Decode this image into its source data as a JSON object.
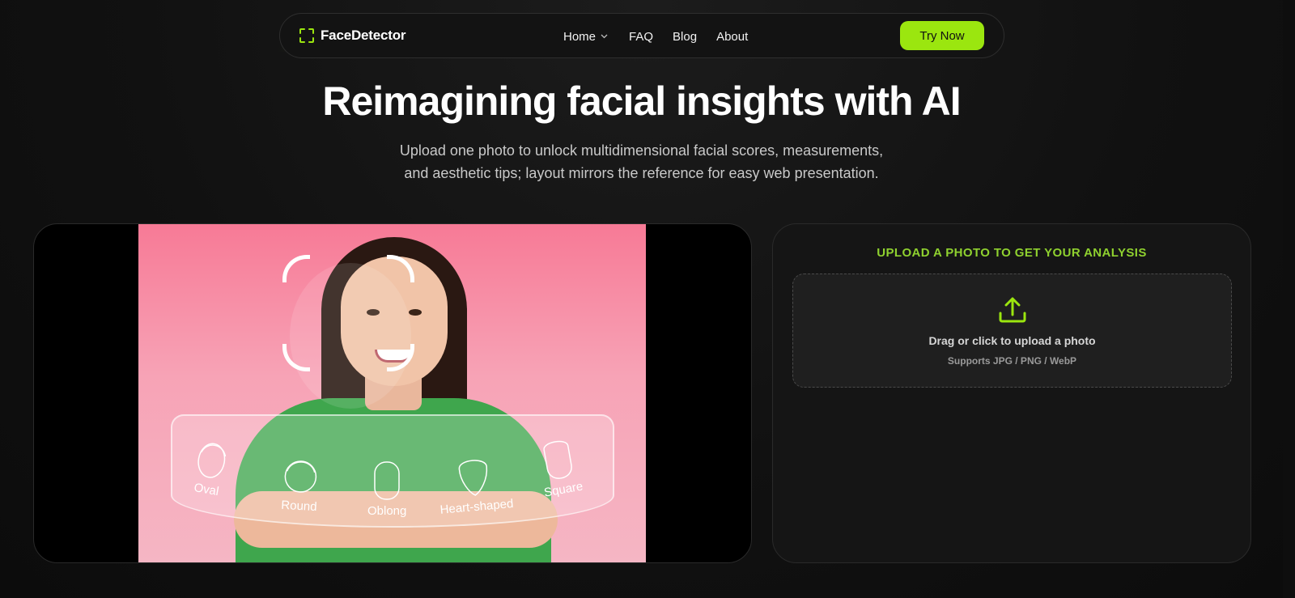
{
  "nav": {
    "brand": "FaceDetector",
    "links": [
      "Home",
      "FAQ",
      "Blog",
      "About"
    ],
    "cta": "Try Now"
  },
  "hero": {
    "title": "Reimagining facial insights with AI",
    "subtitle_line1": "Upload one photo to unlock multidimensional facial scores, measurements,",
    "subtitle_line2": "and aesthetic tips; layout mirrors the reference for easy web presentation."
  },
  "showcase": {
    "face_shapes": [
      "Oval",
      "Round",
      "Oblong",
      "Heart-shaped",
      "Square"
    ]
  },
  "upload": {
    "heading": "UPLOAD A PHOTO TO GET YOUR ANALYSIS",
    "drop_text": "Drag or click to upload a photo",
    "hint": "Supports JPG / PNG / WebP"
  },
  "colors": {
    "accent": "#9be60f",
    "heading_accent": "#8fd12f",
    "background": "#111111"
  }
}
